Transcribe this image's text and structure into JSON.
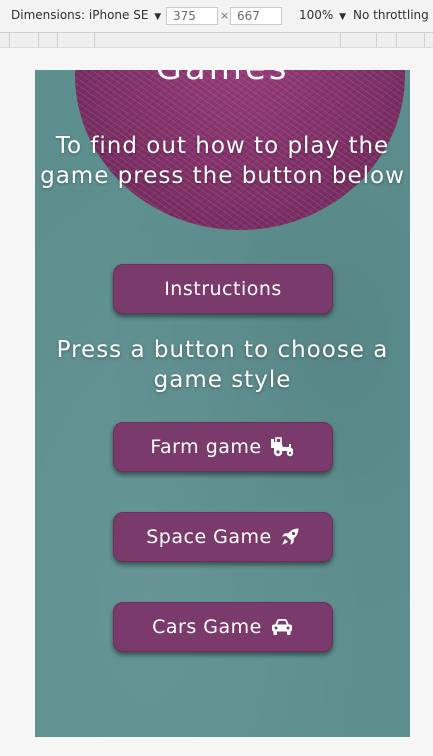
{
  "devtools": {
    "dimensions_label": "Dimensions: iPhone SE",
    "width_value": "375",
    "height_value": "667",
    "times_sign": "×",
    "zoom": "100%",
    "throttling": "No throttling",
    "caret": "▼"
  },
  "page": {
    "heading_fragment": "Games",
    "intro_text": "To find out how to play the game press the button below",
    "instructions_button": "Instructions",
    "choose_text": "Press a button to choose a game style",
    "buttons": [
      {
        "label": "Farm game",
        "icon": "tractor-icon"
      },
      {
        "label": "Space Game",
        "icon": "rocket-icon"
      },
      {
        "label": "Cars Game",
        "icon": "car-icon"
      }
    ],
    "colors": {
      "background": "#5e8f8f",
      "button": "#7b3a6c",
      "yarn": "#8a3470",
      "text": "#ffffff"
    }
  }
}
